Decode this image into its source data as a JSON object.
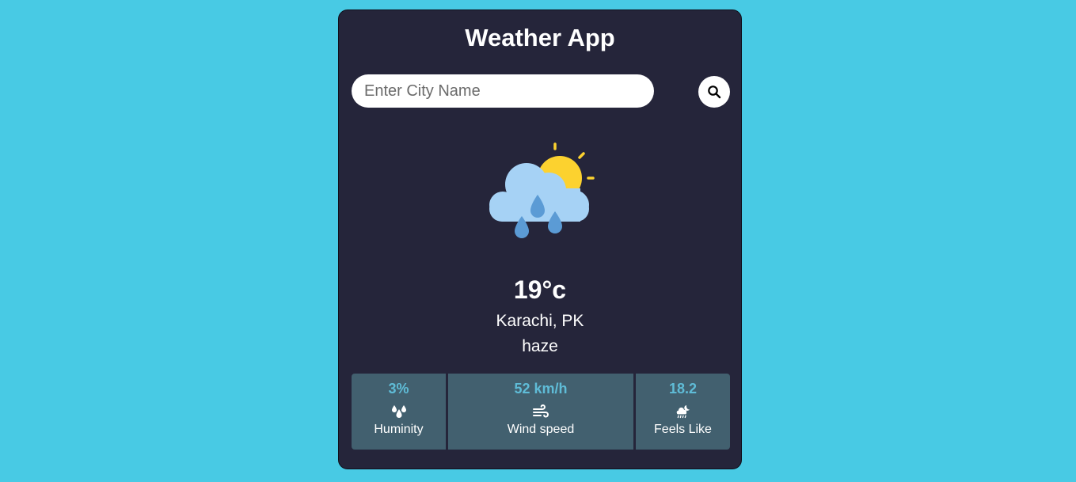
{
  "app": {
    "title": "Weather App"
  },
  "search": {
    "placeholder": "Enter City Name",
    "value": "",
    "button_icon": "search-icon"
  },
  "weather": {
    "icon": "rain-sun-cloud-icon",
    "temperature": "19°c",
    "location": "Karachi, PK",
    "condition": "haze"
  },
  "stats": [
    {
      "value": "3%",
      "label": "Huminity",
      "icon": "humidity-drops-icon"
    },
    {
      "value": "52 km/h",
      "label": "Wind speed",
      "icon": "wind-icon"
    },
    {
      "value": "18.2",
      "label": "Feels Like",
      "icon": "cloud-moon-rain-icon"
    }
  ],
  "colors": {
    "background": "#48cae4",
    "card": "#25253a",
    "stat_tile": "#42606f",
    "stat_value": "#5fbcd7",
    "sun": "#fcd22f",
    "cloud": "#a6d2f5",
    "rain": "#5b9bd5"
  }
}
